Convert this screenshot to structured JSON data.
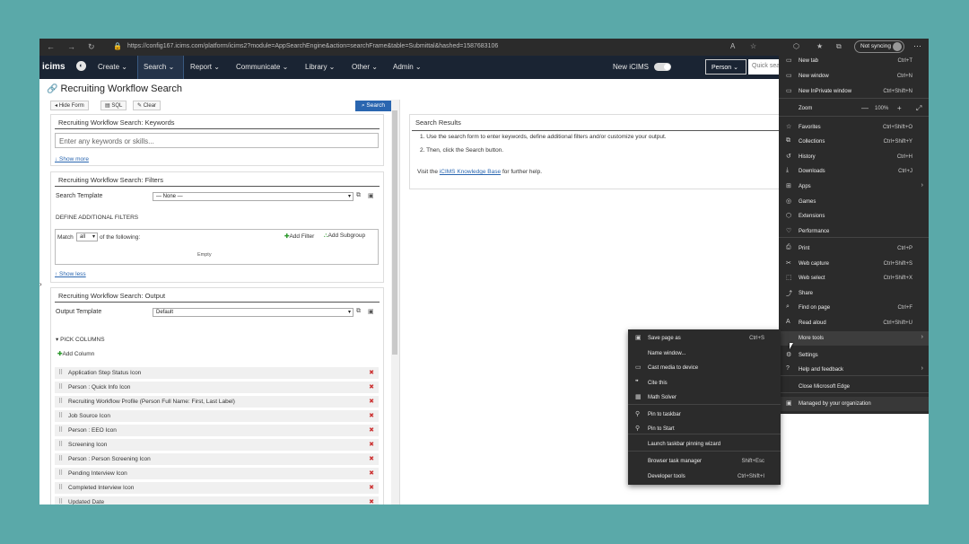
{
  "browser": {
    "url": "https://config167.icims.com/platform/icims2?module=AppSearchEngine&action=searchFrame&table=Submittal&hashed=1587683106",
    "sync_label": "Not syncing"
  },
  "topnav": {
    "logo": "icims",
    "items": [
      "Create",
      "Search",
      "Report",
      "Communicate",
      "Library",
      "Other",
      "Admin"
    ],
    "new_icims": "New iCIMS",
    "person": "Person",
    "quick": "Quick sea"
  },
  "page": {
    "title": "Recruiting Workflow Search"
  },
  "toolbar": {
    "hide_form": "Hide Form",
    "sql": "SQL",
    "clear": "Clear",
    "search": "Search"
  },
  "keywords": {
    "header": "Recruiting Workflow Search: Keywords",
    "placeholder": "Enter any keywords or skills...",
    "show_more": "↓ Show more"
  },
  "filters": {
    "header": "Recruiting Workflow Search: Filters",
    "template_label": "Search Template",
    "template_value": "— None —",
    "define": "DEFINE ADDITIONAL FILTERS",
    "match_pre": "Match",
    "match_value": "all",
    "match_post": "of the following:",
    "add_filter": "Add Filter",
    "add_subgroup": "Add Subgroup",
    "empty": "Empty",
    "show_less": "↑ Show less"
  },
  "output": {
    "header": "Recruiting Workflow Search: Output",
    "template_label": "Output Template",
    "template_value": "Default",
    "pick": "PICK COLUMNS",
    "add_column": "Add Column",
    "columns": [
      "Application Step Status Icon",
      "Person : Quick Info Icon",
      "Recruiting Workflow Profile (Person Full Name: First, Last Label)",
      "Job Source Icon",
      "Person : EEO Icon",
      "Screening Icon",
      "Person : Person Screening Icon",
      "Pending Interview Icon",
      "Completed Interview Icon",
      "Updated Date"
    ]
  },
  "results": {
    "header": "Search Results",
    "step1": "1. Use the search form to enter keywords, define additional filters and/or customize your output.",
    "step2": "2. Then, click the Search button.",
    "visit_pre": "Visit the",
    "visit_link": "iCIMS Knowledge Base",
    "visit_post": "for further help."
  },
  "edge_menu": {
    "items": [
      {
        "label": "New tab",
        "shortcut": "Ctrl+T"
      },
      {
        "label": "New window",
        "shortcut": "Ctrl+N"
      },
      {
        "label": "New InPrivate window",
        "shortcut": "Ctrl+Shift+N"
      },
      {
        "label": "Zoom",
        "shortcut": "100%"
      },
      {
        "label": "Favorites",
        "shortcut": "Ctrl+Shift+O"
      },
      {
        "label": "Collections",
        "shortcut": "Ctrl+Shift+Y"
      },
      {
        "label": "History",
        "shortcut": "Ctrl+H"
      },
      {
        "label": "Downloads",
        "shortcut": "Ctrl+J"
      },
      {
        "label": "Apps",
        "shortcut": ""
      },
      {
        "label": "Games",
        "shortcut": ""
      },
      {
        "label": "Extensions",
        "shortcut": ""
      },
      {
        "label": "Performance",
        "shortcut": ""
      },
      {
        "label": "Print",
        "shortcut": "Ctrl+P"
      },
      {
        "label": "Web capture",
        "shortcut": "Ctrl+Shift+S"
      },
      {
        "label": "Web select",
        "shortcut": "Ctrl+Shift+X"
      },
      {
        "label": "Share",
        "shortcut": ""
      },
      {
        "label": "Find on page",
        "shortcut": "Ctrl+F"
      },
      {
        "label": "Read aloud",
        "shortcut": "Ctrl+Shift+U"
      },
      {
        "label": "More tools",
        "shortcut": ""
      },
      {
        "label": "Settings",
        "shortcut": ""
      },
      {
        "label": "Help and feedback",
        "shortcut": ""
      },
      {
        "label": "Close Microsoft Edge",
        "shortcut": ""
      },
      {
        "label": "Managed by your organization",
        "shortcut": ""
      }
    ]
  },
  "more_tools": {
    "items": [
      {
        "label": "Save page as",
        "shortcut": "Ctrl+S"
      },
      {
        "label": "Name window...",
        "shortcut": ""
      },
      {
        "label": "Cast media to device",
        "shortcut": ""
      },
      {
        "label": "Cite this",
        "shortcut": ""
      },
      {
        "label": "Math Solver",
        "shortcut": ""
      },
      {
        "label": "Pin to taskbar",
        "shortcut": ""
      },
      {
        "label": "Pin to Start",
        "shortcut": ""
      },
      {
        "label": "Launch taskbar pinning wizard",
        "shortcut": ""
      },
      {
        "label": "Browser task manager",
        "shortcut": "Shift+Esc"
      },
      {
        "label": "Developer tools",
        "shortcut": "Ctrl+Shift+I"
      }
    ]
  }
}
